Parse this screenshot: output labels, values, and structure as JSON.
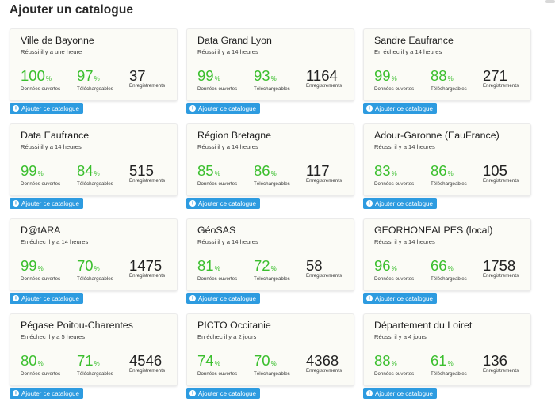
{
  "page": {
    "title": "Ajouter un catalogue"
  },
  "labels": {
    "open_data": "Données ouvertes",
    "downloadable": "Téléchargeables",
    "records": "Enregistrements",
    "add_button": "Ajouter ce catalogue",
    "percent": "%"
  },
  "catalogs": [
    {
      "name": "Ville de Bayonne",
      "status": "Réussi il y a une heure",
      "open": "100",
      "download": "97",
      "records": "37"
    },
    {
      "name": "Data Grand Lyon",
      "status": "Réussi il y a 14 heures",
      "open": "99",
      "download": "93",
      "records": "1164"
    },
    {
      "name": "Sandre Eaufrance",
      "status": "En échec il y a 14 heures",
      "open": "99",
      "download": "88",
      "records": "271"
    },
    {
      "name": "Data Eaufrance",
      "status": "Réussi il y a 14 heures",
      "open": "99",
      "download": "84",
      "records": "515"
    },
    {
      "name": "Région Bretagne",
      "status": "Réussi il y a 14 heures",
      "open": "85",
      "download": "86",
      "records": "117"
    },
    {
      "name": "Adour-Garonne (EauFrance)",
      "status": "Réussi il y a 14 heures",
      "open": "83",
      "download": "86",
      "records": "105"
    },
    {
      "name": "D@tARA",
      "status": "En échec il y a 14 heures",
      "open": "99",
      "download": "70",
      "records": "1475"
    },
    {
      "name": "GéoSAS",
      "status": "Réussi il y a 14 heures",
      "open": "81",
      "download": "72",
      "records": "58"
    },
    {
      "name": "GEORHONEALPES (local)",
      "status": "Réussi il y a 14 heures",
      "open": "96",
      "download": "66",
      "records": "1758"
    },
    {
      "name": "Pégase Poitou-Charentes",
      "status": "En échec il y a 5 heures",
      "open": "80",
      "download": "71",
      "records": "4546"
    },
    {
      "name": "PICTO Occitanie",
      "status": "En échec il y a 2 jours",
      "open": "74",
      "download": "70",
      "records": "4368"
    },
    {
      "name": "Département du Loiret",
      "status": "Réussi il y a 4 jours",
      "open": "88",
      "download": "61",
      "records": "136"
    }
  ],
  "colors": {
    "accent": "#2d9be0",
    "success": "#3bbf2e",
    "card_bg": "#fbfbf6"
  }
}
